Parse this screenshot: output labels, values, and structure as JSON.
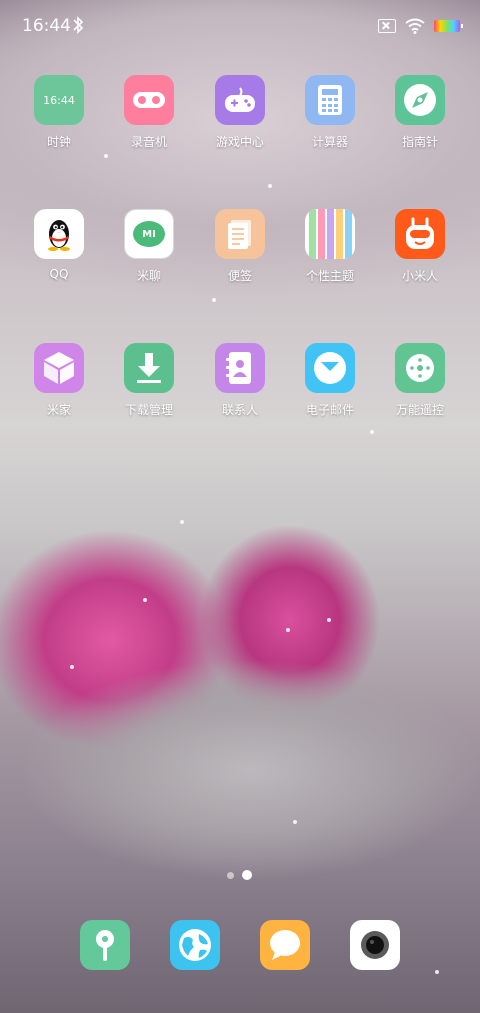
{
  "status_bar": {
    "time": "16:44",
    "icons": [
      "bluetooth-icon",
      "sim-off-icon",
      "wifi-icon",
      "battery-icon"
    ]
  },
  "apps": [
    {
      "label": "时钟",
      "icon": "clock-icon",
      "color": "#6dc59a",
      "icon_text": "16:44"
    },
    {
      "label": "录音机",
      "icon": "recorder-icon",
      "color": "#ff7d9d"
    },
    {
      "label": "游戏中心",
      "icon": "gamepad-icon",
      "color": "#a67be8"
    },
    {
      "label": "计算器",
      "icon": "calculator-icon",
      "color": "#8fb8f2"
    },
    {
      "label": "指南针",
      "icon": "compass-icon",
      "color": "#5cc497"
    },
    {
      "label": "QQ",
      "icon": "qq-penguin-icon",
      "color": "#ffffff"
    },
    {
      "label": "米聊",
      "icon": "miliao-icon",
      "color": "#ffffff",
      "icon_text": "MI"
    },
    {
      "label": "便签",
      "icon": "notes-icon",
      "color": "#f6c39a"
    },
    {
      "label": "个性主题",
      "icon": "themes-icon",
      "color": "#ffffff"
    },
    {
      "label": "小米人",
      "icon": "mi-bunny-icon",
      "color": "#ff5a1a"
    },
    {
      "label": "米家",
      "icon": "mijia-cube-icon",
      "color": "#cf86e8"
    },
    {
      "label": "下载管理",
      "icon": "download-icon",
      "color": "#5cc08e"
    },
    {
      "label": "联系人",
      "icon": "contacts-icon",
      "color": "#c486e8"
    },
    {
      "label": "电子邮件",
      "icon": "email-icon",
      "color": "#41c3f5"
    },
    {
      "label": "万能遥控",
      "icon": "remote-icon",
      "color": "#60c593"
    }
  ],
  "page_indicator": {
    "pages": 2,
    "active": 2
  },
  "dock": [
    {
      "icon": "security-icon",
      "color": "#63c89a"
    },
    {
      "icon": "browser-globe-icon",
      "color": "#3dc3f0"
    },
    {
      "icon": "messages-icon",
      "color": "#ffb340"
    },
    {
      "icon": "camera-icon",
      "color": "#ffffff"
    }
  ]
}
